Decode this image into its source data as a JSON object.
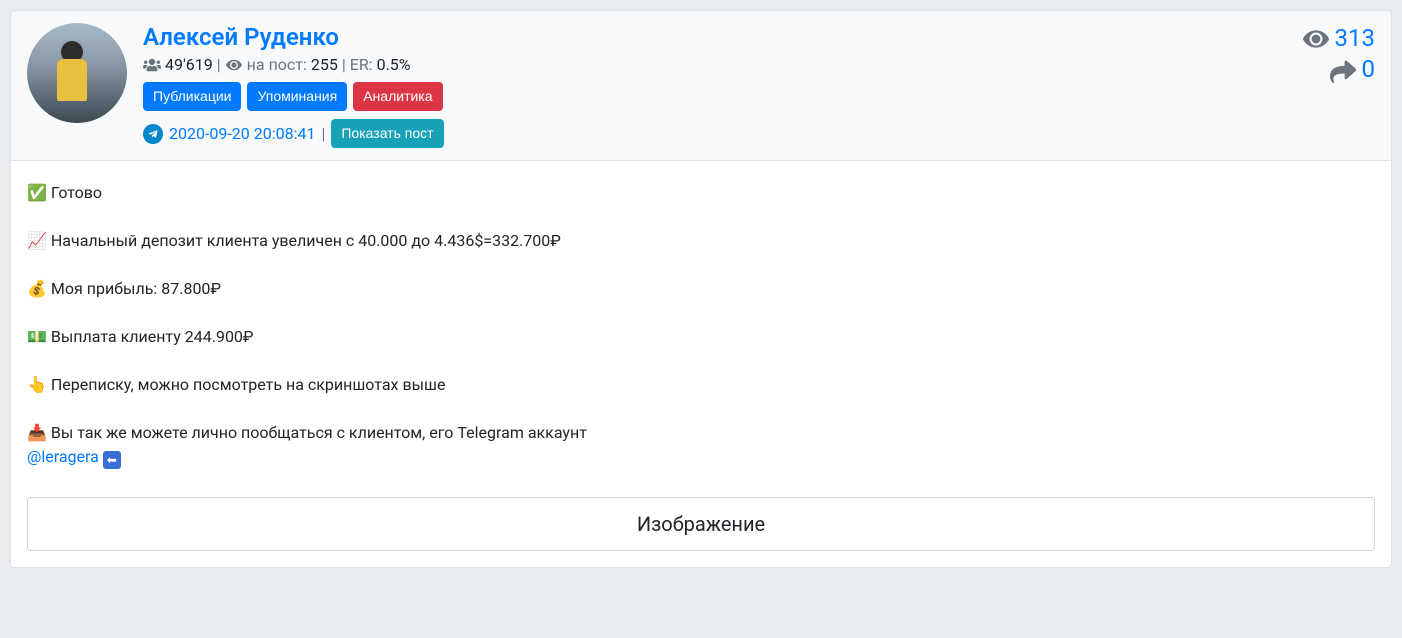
{
  "channel": {
    "name": "Алексей Руденко",
    "subscribers": "49'619",
    "per_post_label": "на пост:",
    "per_post_value": "255",
    "er_label": "ER:",
    "er_value": "0.5%"
  },
  "tabs": {
    "publications": "Публикации",
    "mentions": "Упоминания",
    "analytics": "Аналитика"
  },
  "meta": {
    "timestamp": "2020-09-20 20:08:41",
    "show_post": "Показать пост"
  },
  "metrics": {
    "views": "313",
    "shares": "0"
  },
  "post": {
    "line1": "Готово",
    "line2": "Начальный депозит клиента увеличен с 40.000 до 4.436$=332.700₽",
    "line3": "Моя прибыль: 87.800₽",
    "line4": "Выплата клиенту 244.900₽",
    "line5": "Переписку, можно посмотреть на скриншотах выше",
    "line6": "Вы так же можете лично пообщаться с клиентом, его Telegram аккаунт",
    "mention": "@leragera"
  },
  "image_button": "Изображение"
}
